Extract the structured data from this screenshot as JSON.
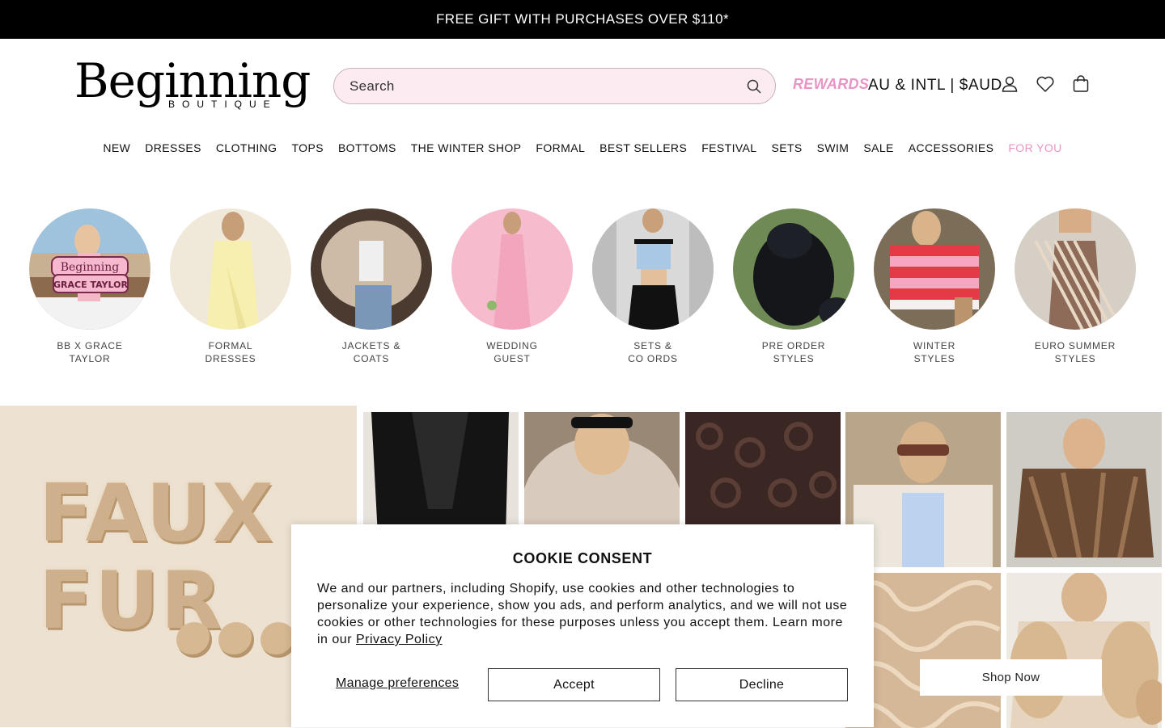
{
  "announcement": {
    "text": "FREE GIFT WITH PURCHASES OVER $110*"
  },
  "header": {
    "logo_text": "Beginning",
    "logo_subtext": "BOUTIQUE",
    "search_placeholder": "Search",
    "rewards_label": "REWARDS",
    "region_label": "AU & INTL | $AUD",
    "icons": [
      "account-icon",
      "wishlist-heart-icon",
      "cart-bag-icon"
    ]
  },
  "nav": {
    "items": [
      "NEW",
      "DRESSES",
      "CLOTHING",
      "TOPS",
      "BOTTOMS",
      "THE WINTER SHOP",
      "FORMAL",
      "BEST SELLERS",
      "FESTIVAL",
      "SETS",
      "SWIM",
      "SALE",
      "ACCESSORIES",
      "FOR YOU"
    ],
    "highlight_color": "#e994c4"
  },
  "categories": [
    {
      "line1": "BB X GRACE",
      "line2": "TAYLOR",
      "badge1": "Beginning",
      "badge2": "GRACE TAYLOR"
    },
    {
      "line1": "FORMAL",
      "line2": "DRESSES"
    },
    {
      "line1": "JACKETS &",
      "line2": "COATS"
    },
    {
      "line1": "WEDDING",
      "line2": "GUEST"
    },
    {
      "line1": "SETS &",
      "line2": "CO ORDS"
    },
    {
      "line1": "PRE ORDER",
      "line2": "STYLES"
    },
    {
      "line1": "WINTER",
      "line2": "STYLES"
    },
    {
      "line1": "EURO SUMMER",
      "line2": "STYLES"
    }
  ],
  "hero": {
    "headline_line1": "FAUX",
    "headline_line2": "FUR",
    "cta_label": "Shop Now"
  },
  "cookie": {
    "title": "COOKIE CONSENT",
    "body": "We and our partners, including Shopify, use cookies and other technologies to personalize your experience, show you ads, and perform analytics, and we will not use cookies or other technologies for these purposes unless you accept them. Learn more in our",
    "policy_link": "Privacy Policy",
    "manage_label": "Manage preferences",
    "accept_label": "Accept",
    "decline_label": "Decline"
  },
  "colors": {
    "brand_pink": "#e994c4",
    "search_bg": "#fdebf2",
    "announce_bg": "#000000"
  }
}
